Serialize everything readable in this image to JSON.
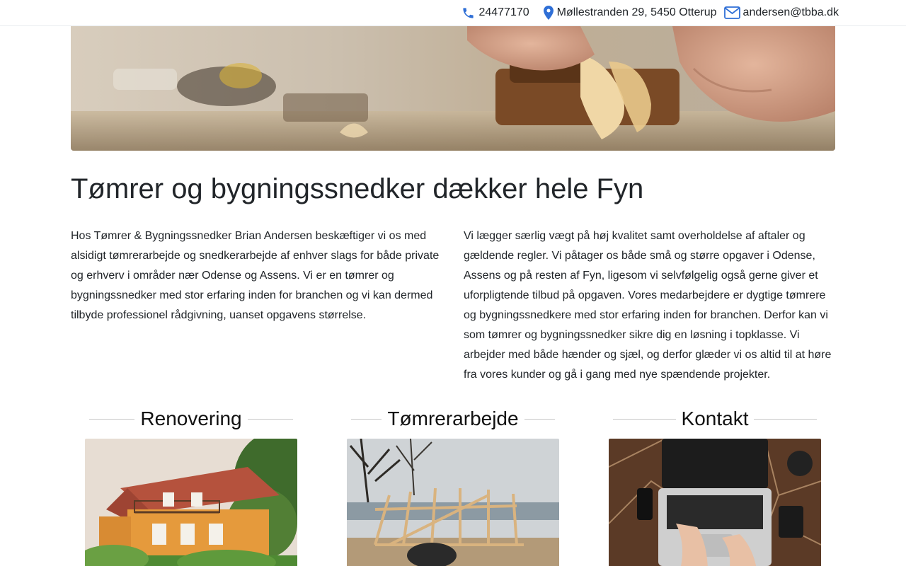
{
  "contact": {
    "phone": "24477170",
    "address": "Møllestranden 29, 5450 Otterup",
    "email": "andersen@tbba.dk",
    "icons": {
      "phone": "phone-icon",
      "address": "map-pin-icon",
      "email": "envelope-icon"
    },
    "accent_color": "#2f6fd6"
  },
  "hero": {
    "image": "carpenter-planing-wood-photo"
  },
  "page": {
    "title": "Tømrer og bygningssnedker dækker hele Fyn",
    "intro_left": "Hos Tømrer & Bygningssnedker Brian Andersen beskæftiger vi os med alsidigt tømrerarbejde og snedkerarbejde af enhver slags for både private og erhverv i områder nær Odense og Assens. Vi er en tømrer og bygningssnedker med stor erfaring inden for branchen og vi kan dermed tilbyde professionel rådgivning, uanset opgavens størrelse.",
    "intro_right": "Vi lægger særlig vægt på høj kvalitet samt overholdelse af aftaler og gældende regler. Vi påtager os både små og større opgaver i Odense, Assens og på resten af Fyn, ligesom vi selvfølgelig også gerne giver et uforpligtende tilbud på opgaven. Vores medarbejdere er dygtige tømrere og bygningssnedkere med stor erfaring inden for branchen. Derfor kan vi som tømrer og bygningssnedker sikre dig en løsning i topklasse. Vi arbejder med både hænder og sjæl, og derfor glæder vi os altid til at høre fra vores kunder og gå i gang med nye spændende projekter."
  },
  "services": [
    {
      "title": "Renovering",
      "image": "orange-house-photo"
    },
    {
      "title": "Tømrerarbejde",
      "image": "timber-frame-construction-photo"
    },
    {
      "title": "Kontakt",
      "image": "laptop-typing-photo"
    }
  ]
}
